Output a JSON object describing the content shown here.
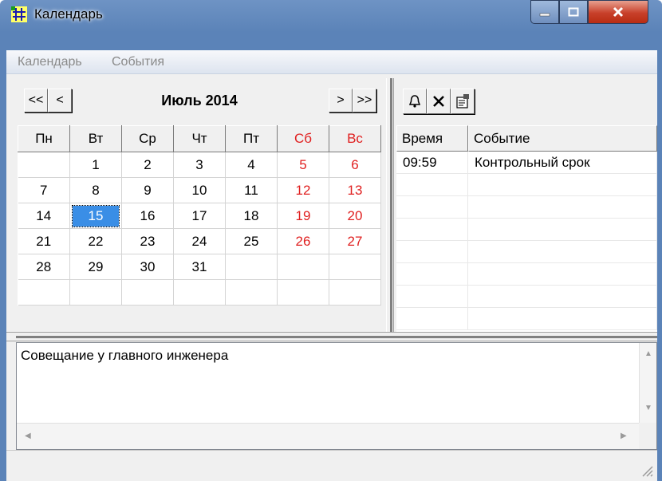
{
  "window": {
    "title": "Календарь"
  },
  "menu": {
    "items": [
      "Календарь",
      "События"
    ]
  },
  "calendar": {
    "nav": {
      "prev_year": "<<",
      "prev_month": "<",
      "next_month": ">",
      "next_year": ">>"
    },
    "month_title": "Июль 2014",
    "weekdays": [
      "Пн",
      "Вт",
      "Ср",
      "Чт",
      "Пт",
      "Сб",
      "Вс"
    ],
    "weeks": [
      [
        "",
        "1",
        "2",
        "3",
        "4",
        "5",
        "6"
      ],
      [
        "7",
        "8",
        "9",
        "10",
        "11",
        "12",
        "13"
      ],
      [
        "14",
        "15",
        "16",
        "17",
        "18",
        "19",
        "20"
      ],
      [
        "21",
        "22",
        "23",
        "24",
        "25",
        "26",
        "27"
      ],
      [
        "28",
        "29",
        "30",
        "31",
        "",
        "",
        ""
      ],
      [
        "",
        "",
        "",
        "",
        "",
        "",
        ""
      ]
    ],
    "selected_day": "15",
    "weekend_color": "#e02020",
    "selection_color": "#3a8ee6"
  },
  "events": {
    "toolbar": [
      "bell-icon",
      "close-icon",
      "properties-icon"
    ],
    "columns": [
      "Время",
      "Событие"
    ],
    "rows": [
      {
        "time": "09:59",
        "event": "Контрольный срок"
      }
    ]
  },
  "memo": {
    "text": "Совещание у главного инженера"
  }
}
